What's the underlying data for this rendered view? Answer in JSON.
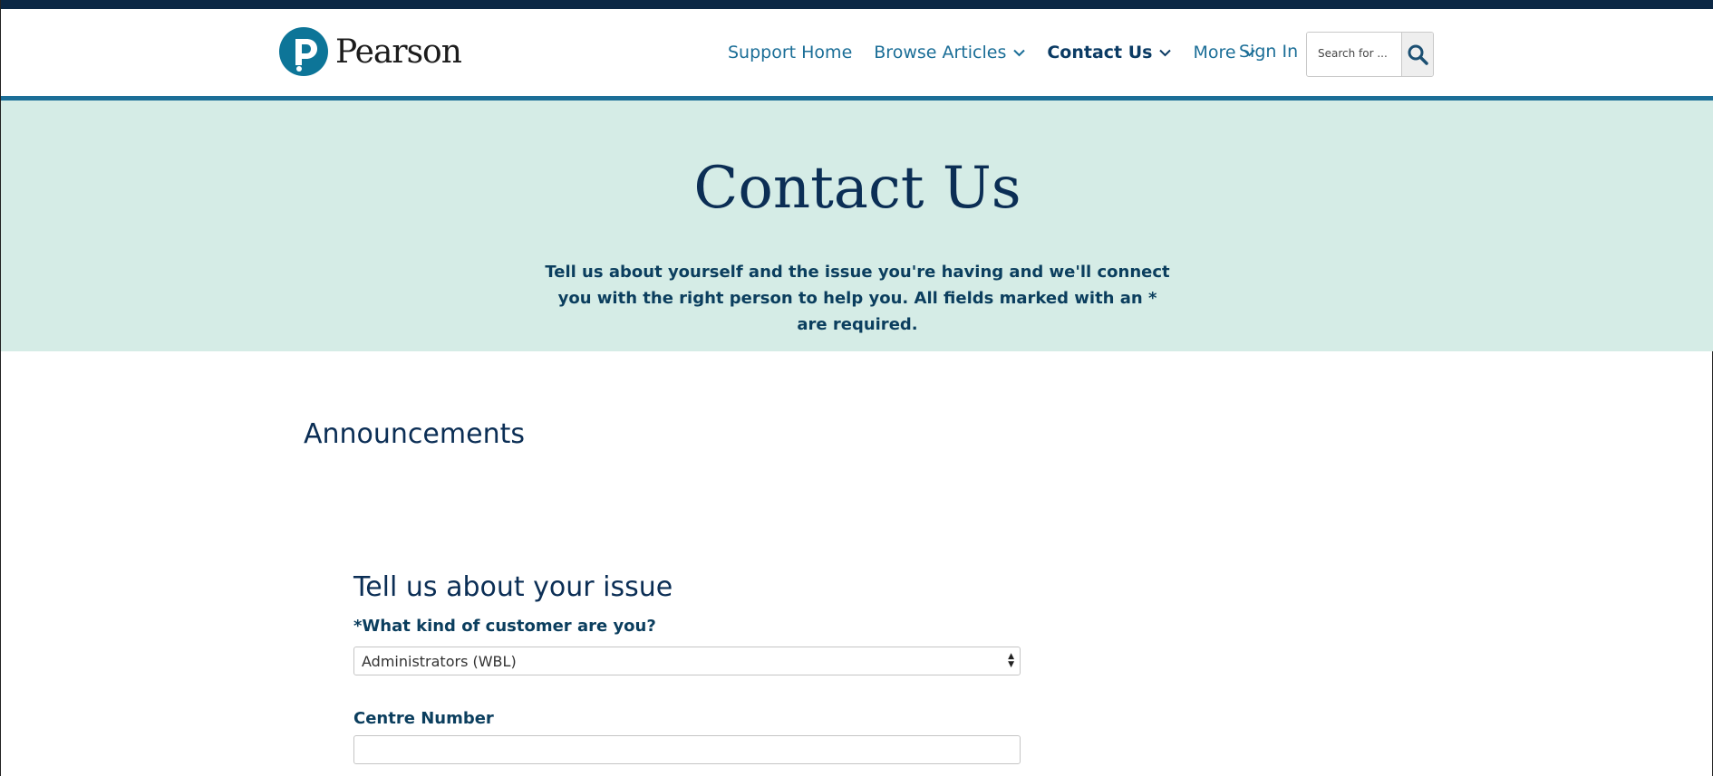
{
  "header": {
    "logo_text": "Pearson",
    "nav": [
      {
        "label": "Support Home",
        "has_dropdown": false
      },
      {
        "label": "Browse Articles",
        "has_dropdown": true
      },
      {
        "label": "Contact Us",
        "has_dropdown": true,
        "active": true
      },
      {
        "label": "More",
        "has_dropdown": true
      }
    ],
    "sign_in": "Sign In",
    "search": {
      "placeholder": "Search for ..."
    }
  },
  "hero": {
    "title": "Contact Us",
    "description": "Tell us about yourself and the issue you're having and we'll connect you with the right person to help you. All fields marked with an * are required."
  },
  "announcements": {
    "heading": "Announcements"
  },
  "form": {
    "title": "Tell us about your issue",
    "customer_type": {
      "label": "*What kind of customer are you?",
      "selected": "Administrators (WBL)"
    },
    "centre_number": {
      "label": "Centre Number",
      "value": ""
    }
  },
  "colors": {
    "top_bar": "#0b2744",
    "accent": "#1b6e97",
    "hero_bg": "#d5ece6",
    "heading": "#0b2e55"
  }
}
